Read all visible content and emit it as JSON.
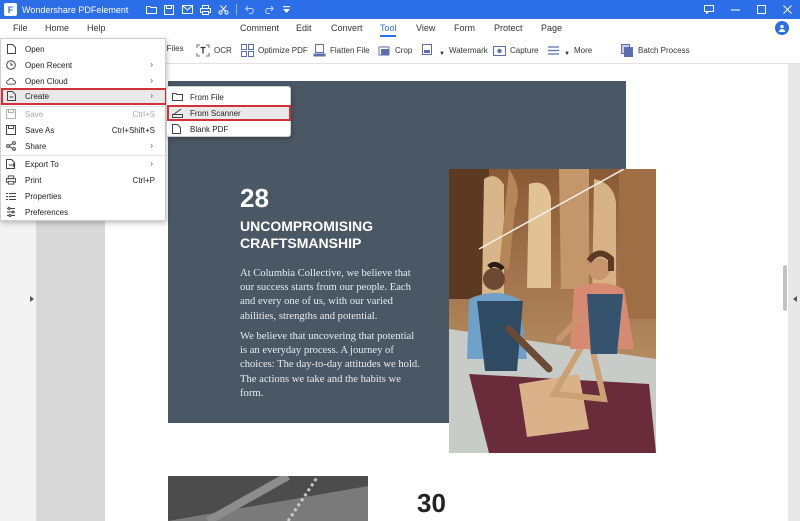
{
  "window": {
    "title": "Wondershare PDFelement",
    "logo_letter": "F"
  },
  "menubar": {
    "file": "File",
    "home": "Home",
    "help": "Help"
  },
  "tabs": [
    {
      "label": "Comment"
    },
    {
      "label": "Edit"
    },
    {
      "label": "Convert"
    },
    {
      "label": "Tool",
      "active": true
    },
    {
      "label": "View"
    },
    {
      "label": "Form"
    },
    {
      "label": "Protect"
    },
    {
      "label": "Page"
    }
  ],
  "toolbar": {
    "combine": "e Files",
    "ocr": "OCR",
    "optimize": "Optimize PDF",
    "flatten": "Flatten File",
    "crop": "Crop",
    "watermark": "Watermark",
    "capture": "Capture",
    "more": "More",
    "batch": "Batch Process"
  },
  "file_menu": {
    "open": "Open",
    "open_recent": "Open Recent",
    "open_cloud": "Open Cloud",
    "create": "Create",
    "save": "Save",
    "save_shortcut": "Ctrl+S",
    "save_as": "Save As",
    "save_as_shortcut": "Ctrl+Shift+S",
    "share": "Share",
    "export_to": "Export To",
    "print": "Print",
    "print_shortcut": "Ctrl+P",
    "properties": "Properties",
    "preferences": "Preferences"
  },
  "create_submenu": {
    "from_file": "From File",
    "from_scanner": "From Scanner",
    "blank_pdf": "Blank PDF"
  },
  "document": {
    "section_number": "28",
    "section_title": "UNCOMPROMISING CRAFTSMANSHIP",
    "paragraph1": "At Columbia Collective, we believe that our success starts from our people. Each and every one of us, with our varied abilities, strengths and potential.",
    "paragraph2": "We believe that uncovering that potential is an everyday process. A journey of choices: The day-to-day attitudes we hold. The actions we take and the habits we form.",
    "next_section_number": "30"
  },
  "colors": {
    "accent": "#2c6ee8",
    "highlight_border": "#d0323a",
    "panel": "#4a5866"
  }
}
